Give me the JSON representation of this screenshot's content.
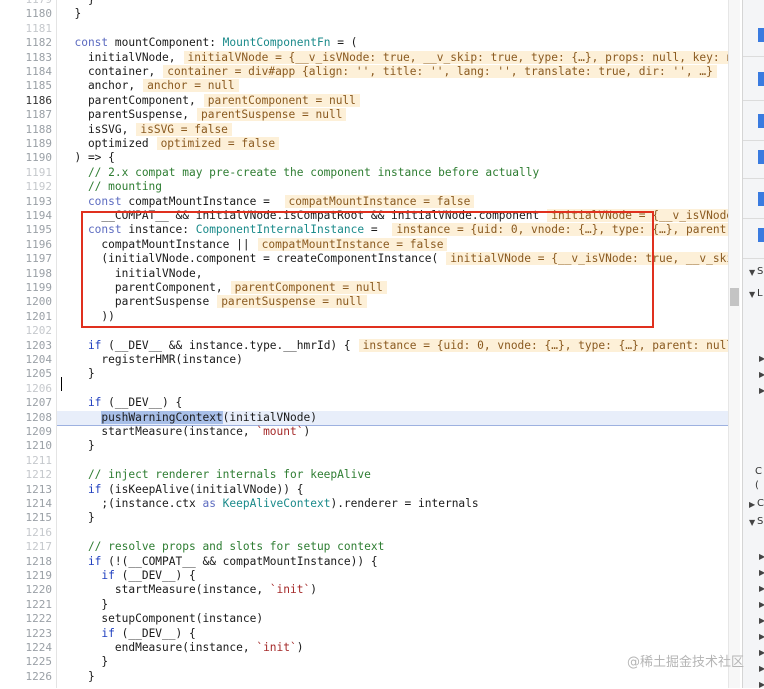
{
  "editor": {
    "highlighted_line": "1208",
    "lines": [
      {
        "n": "1179",
        "style": "dim",
        "segs": [
          {
            "t": "    }",
            "c": "pn"
          }
        ]
      },
      {
        "n": "1180",
        "style": "",
        "segs": [
          {
            "t": "  }",
            "c": "pn"
          }
        ]
      },
      {
        "n": "1181",
        "style": "dim",
        "segs": []
      },
      {
        "n": "1182",
        "style": "",
        "segs": [
          {
            "t": "  const ",
            "c": "kw"
          },
          {
            "t": "mountComponent",
            "c": "pn"
          },
          {
            "t": ": ",
            "c": "pn"
          },
          {
            "t": "MountComponentFn",
            "c": "ty"
          },
          {
            "t": " = (",
            "c": "pn"
          }
        ]
      },
      {
        "n": "1183",
        "style": "",
        "segs": [
          {
            "t": "    initialVNode,",
            "c": "pn"
          },
          {
            "t": "initialVNode = {__v_isVNode: true, __v_skip: true, type: {…}, props: null, key: nu",
            "c": "inl"
          }
        ]
      },
      {
        "n": "1184",
        "style": "",
        "segs": [
          {
            "t": "    container,",
            "c": "pn"
          },
          {
            "t": "container = div#app {align: '', title: '', lang: '', translate: true, dir: '', …}",
            "c": "inl"
          }
        ]
      },
      {
        "n": "1185",
        "style": "",
        "segs": [
          {
            "t": "    anchor,",
            "c": "pn"
          },
          {
            "t": "anchor = null",
            "c": "inl"
          }
        ]
      },
      {
        "n": "1186",
        "style": "cur",
        "segs": [
          {
            "t": "    parentComponent,",
            "c": "pn"
          },
          {
            "t": "parentComponent = null",
            "c": "inl"
          }
        ]
      },
      {
        "n": "1187",
        "style": "",
        "segs": [
          {
            "t": "    parentSuspense,",
            "c": "pn"
          },
          {
            "t": "parentSuspense = null",
            "c": "inl"
          }
        ]
      },
      {
        "n": "1188",
        "style": "",
        "segs": [
          {
            "t": "    isSVG,",
            "c": "pn"
          },
          {
            "t": "isSVG = false",
            "c": "inl"
          }
        ]
      },
      {
        "n": "1189",
        "style": "",
        "segs": [
          {
            "t": "    optimized",
            "c": "pn"
          },
          {
            "t": "optimized = false",
            "c": "inl"
          }
        ]
      },
      {
        "n": "1190",
        "style": "",
        "segs": [
          {
            "t": "  ) => {",
            "c": "pn"
          }
        ]
      },
      {
        "n": "1191",
        "style": "dim",
        "segs": [
          {
            "t": "    // 2.x compat may pre-create the component instance before actually",
            "c": "cm"
          }
        ]
      },
      {
        "n": "1192",
        "style": "dim",
        "segs": [
          {
            "t": "    // mounting",
            "c": "cm"
          }
        ]
      },
      {
        "n": "1193",
        "style": "",
        "segs": [
          {
            "t": "    const ",
            "c": "kw"
          },
          {
            "t": "compatMountInstance = ",
            "c": "pn"
          },
          {
            "t": "compatMountInstance = false",
            "c": "inl"
          }
        ]
      },
      {
        "n": "1194",
        "style": "",
        "segs": [
          {
            "t": "      __COMPAT__ && initialVNode.isCompatRoot && initialVNode.component",
            "c": "pn"
          },
          {
            "t": "initialVNode = {__v_isVNode:",
            "c": "inl"
          }
        ]
      },
      {
        "n": "1195",
        "style": "",
        "segs": [
          {
            "t": "    const ",
            "c": "kw"
          },
          {
            "t": "instance: ",
            "c": "pn"
          },
          {
            "t": "ComponentInternalInstance",
            "c": "ty"
          },
          {
            "t": " = ",
            "c": "pn"
          },
          {
            "t": "instance = {uid: 0, vnode: {…}, type: {…}, parent: n",
            "c": "inl"
          }
        ]
      },
      {
        "n": "1196",
        "style": "",
        "segs": [
          {
            "t": "      compatMountInstance ||",
            "c": "pn"
          },
          {
            "t": "compatMountInstance = false",
            "c": "inl"
          }
        ]
      },
      {
        "n": "1197",
        "style": "",
        "segs": [
          {
            "t": "      (initialVNode.component = createComponentInstance(",
            "c": "pn"
          },
          {
            "t": "initialVNode = {__v_isVNode: true, __v_skip",
            "c": "inl"
          }
        ]
      },
      {
        "n": "1198",
        "style": "",
        "segs": [
          {
            "t": "        initialVNode,",
            "c": "pn"
          }
        ]
      },
      {
        "n": "1199",
        "style": "",
        "segs": [
          {
            "t": "        parentComponent,",
            "c": "pn"
          },
          {
            "t": "parentComponent = null",
            "c": "inl"
          }
        ]
      },
      {
        "n": "1200",
        "style": "",
        "segs": [
          {
            "t": "        parentSuspense",
            "c": "pn"
          },
          {
            "t": "parentSuspense = null",
            "c": "inl"
          }
        ]
      },
      {
        "n": "1201",
        "style": "",
        "segs": [
          {
            "t": "      ))",
            "c": "pn"
          }
        ]
      },
      {
        "n": "1202",
        "style": "dim",
        "segs": []
      },
      {
        "n": "1203",
        "style": "",
        "segs": [
          {
            "t": "    if ",
            "c": "kw2"
          },
          {
            "t": "(__DEV__ && instance.type.__hmrId) {",
            "c": "pn"
          },
          {
            "t": "instance = {uid: 0, vnode: {…}, type: {…}, parent: null,",
            "c": "inl"
          }
        ]
      },
      {
        "n": "1204",
        "style": "",
        "segs": [
          {
            "t": "      registerHMR(instance)",
            "c": "pn"
          }
        ]
      },
      {
        "n": "1205",
        "style": "",
        "segs": [
          {
            "t": "    }",
            "c": "pn"
          }
        ]
      },
      {
        "n": "1206",
        "style": "dim",
        "segs": []
      },
      {
        "n": "1207",
        "style": "",
        "segs": [
          {
            "t": "    if ",
            "c": "kw2"
          },
          {
            "t": "(__DEV__) {",
            "c": "pn"
          }
        ]
      },
      {
        "n": "1208",
        "style": "hl",
        "segs": [
          {
            "t": "      ",
            "c": "pn"
          },
          {
            "t": "pushWarningContext",
            "c": "sel"
          },
          {
            "t": "(initialVNode)",
            "c": "pn"
          }
        ]
      },
      {
        "n": "1209",
        "style": "",
        "segs": [
          {
            "t": "      startMeasure(instance, ",
            "c": "pn"
          },
          {
            "t": "`mount`",
            "c": "st"
          },
          {
            "t": ")",
            "c": "pn"
          }
        ]
      },
      {
        "n": "1210",
        "style": "",
        "segs": [
          {
            "t": "    }",
            "c": "pn"
          }
        ]
      },
      {
        "n": "1211",
        "style": "dim",
        "segs": []
      },
      {
        "n": "1212",
        "style": "dim",
        "segs": [
          {
            "t": "    // inject renderer internals for keepAlive",
            "c": "cm"
          }
        ]
      },
      {
        "n": "1213",
        "style": "",
        "segs": [
          {
            "t": "    if ",
            "c": "kw2"
          },
          {
            "t": "(isKeepAlive(initialVNode)) {",
            "c": "pn"
          }
        ]
      },
      {
        "n": "1214",
        "style": "",
        "segs": [
          {
            "t": "      ;(instance.ctx ",
            "c": "pn"
          },
          {
            "t": "as ",
            "c": "kw"
          },
          {
            "t": "KeepAliveContext",
            "c": "ty"
          },
          {
            "t": ").renderer = internals",
            "c": "pn"
          }
        ]
      },
      {
        "n": "1215",
        "style": "",
        "segs": [
          {
            "t": "    }",
            "c": "pn"
          }
        ]
      },
      {
        "n": "1216",
        "style": "dim",
        "segs": []
      },
      {
        "n": "1217",
        "style": "dim",
        "segs": [
          {
            "t": "    // resolve props and slots for setup context",
            "c": "cm"
          }
        ]
      },
      {
        "n": "1218",
        "style": "",
        "segs": [
          {
            "t": "    if ",
            "c": "kw2"
          },
          {
            "t": "(!(__COMPAT__ && compatMountInstance)) {",
            "c": "pn"
          }
        ]
      },
      {
        "n": "1219",
        "style": "",
        "segs": [
          {
            "t": "      if ",
            "c": "kw2"
          },
          {
            "t": "(__DEV__) {",
            "c": "pn"
          }
        ]
      },
      {
        "n": "1220",
        "style": "",
        "segs": [
          {
            "t": "        startMeasure(instance, ",
            "c": "pn"
          },
          {
            "t": "`init`",
            "c": "st"
          },
          {
            "t": ")",
            "c": "pn"
          }
        ]
      },
      {
        "n": "1221",
        "style": "",
        "segs": [
          {
            "t": "      }",
            "c": "pn"
          }
        ]
      },
      {
        "n": "1222",
        "style": "",
        "segs": [
          {
            "t": "      setupComponent(instance)",
            "c": "pn"
          }
        ]
      },
      {
        "n": "1223",
        "style": "",
        "segs": [
          {
            "t": "      if ",
            "c": "kw2"
          },
          {
            "t": "(__DEV__) {",
            "c": "pn"
          }
        ]
      },
      {
        "n": "1224",
        "style": "",
        "segs": [
          {
            "t": "        endMeasure(instance, ",
            "c": "pn"
          },
          {
            "t": "`init`",
            "c": "st"
          },
          {
            "t": ")",
            "c": "pn"
          }
        ]
      },
      {
        "n": "1225",
        "style": "",
        "segs": [
          {
            "t": "      }",
            "c": "pn"
          }
        ]
      },
      {
        "n": "1226",
        "style": "",
        "segs": [
          {
            "t": "    }",
            "c": "pn"
          }
        ]
      }
    ]
  },
  "devtools": {
    "section_letters": [
      "S",
      "L",
      "C",
      "(",
      "C",
      "S"
    ]
  },
  "watermark": "@稀土掘金技术社区",
  "colors": {
    "highlight_box": "#e0301e",
    "accent": "#3a7be0"
  }
}
